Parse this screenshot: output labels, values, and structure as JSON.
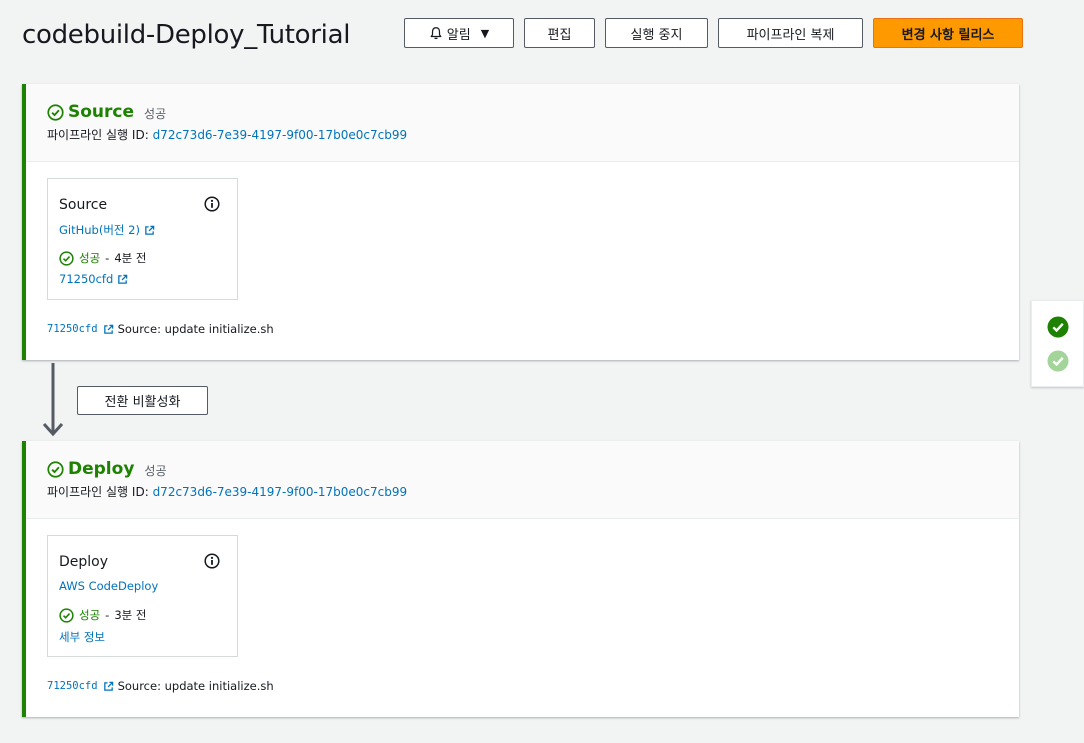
{
  "header": {
    "title": "codebuild-Deploy_Tutorial",
    "buttons": {
      "notify": "알림",
      "edit": "편집",
      "stop": "실행 중지",
      "clone": "파이프라인 복제",
      "release": "변경 사항 릴리스"
    }
  },
  "stages": [
    {
      "name": "Source",
      "status": "성공",
      "exec_label": "파이프라인 실행 ID:",
      "exec_id": "d72c73d6-7e39-4197-9f00-17b0e0c7cb99",
      "action": {
        "name": "Source",
        "provider": "GitHub(버전 2)",
        "status": "성공",
        "sep": "-",
        "time": "4분 전",
        "link": "71250cfd"
      },
      "commit": {
        "id": "71250cfd",
        "message": "Source: update initialize.sh"
      }
    },
    {
      "name": "Deploy",
      "status": "성공",
      "exec_label": "파이프라인 실행 ID:",
      "exec_id": "d72c73d6-7e39-4197-9f00-17b0e0c7cb99",
      "action": {
        "name": "Deploy",
        "provider": "AWS CodeDeploy",
        "status": "성공",
        "sep": "-",
        "time": "3분 전",
        "link": "세부 정보"
      },
      "commit": {
        "id": "71250cfd",
        "message": "Source: update initialize.sh"
      }
    }
  ],
  "transition": {
    "button": "전환 비활성화"
  },
  "colors": {
    "success": "#1d8102",
    "link": "#0073bb",
    "primary": "#ff9900"
  },
  "icons": [
    "bell-icon",
    "caret-down-icon",
    "check-circle-icon",
    "info-icon",
    "external-link-icon",
    "arrow-down-icon"
  ]
}
